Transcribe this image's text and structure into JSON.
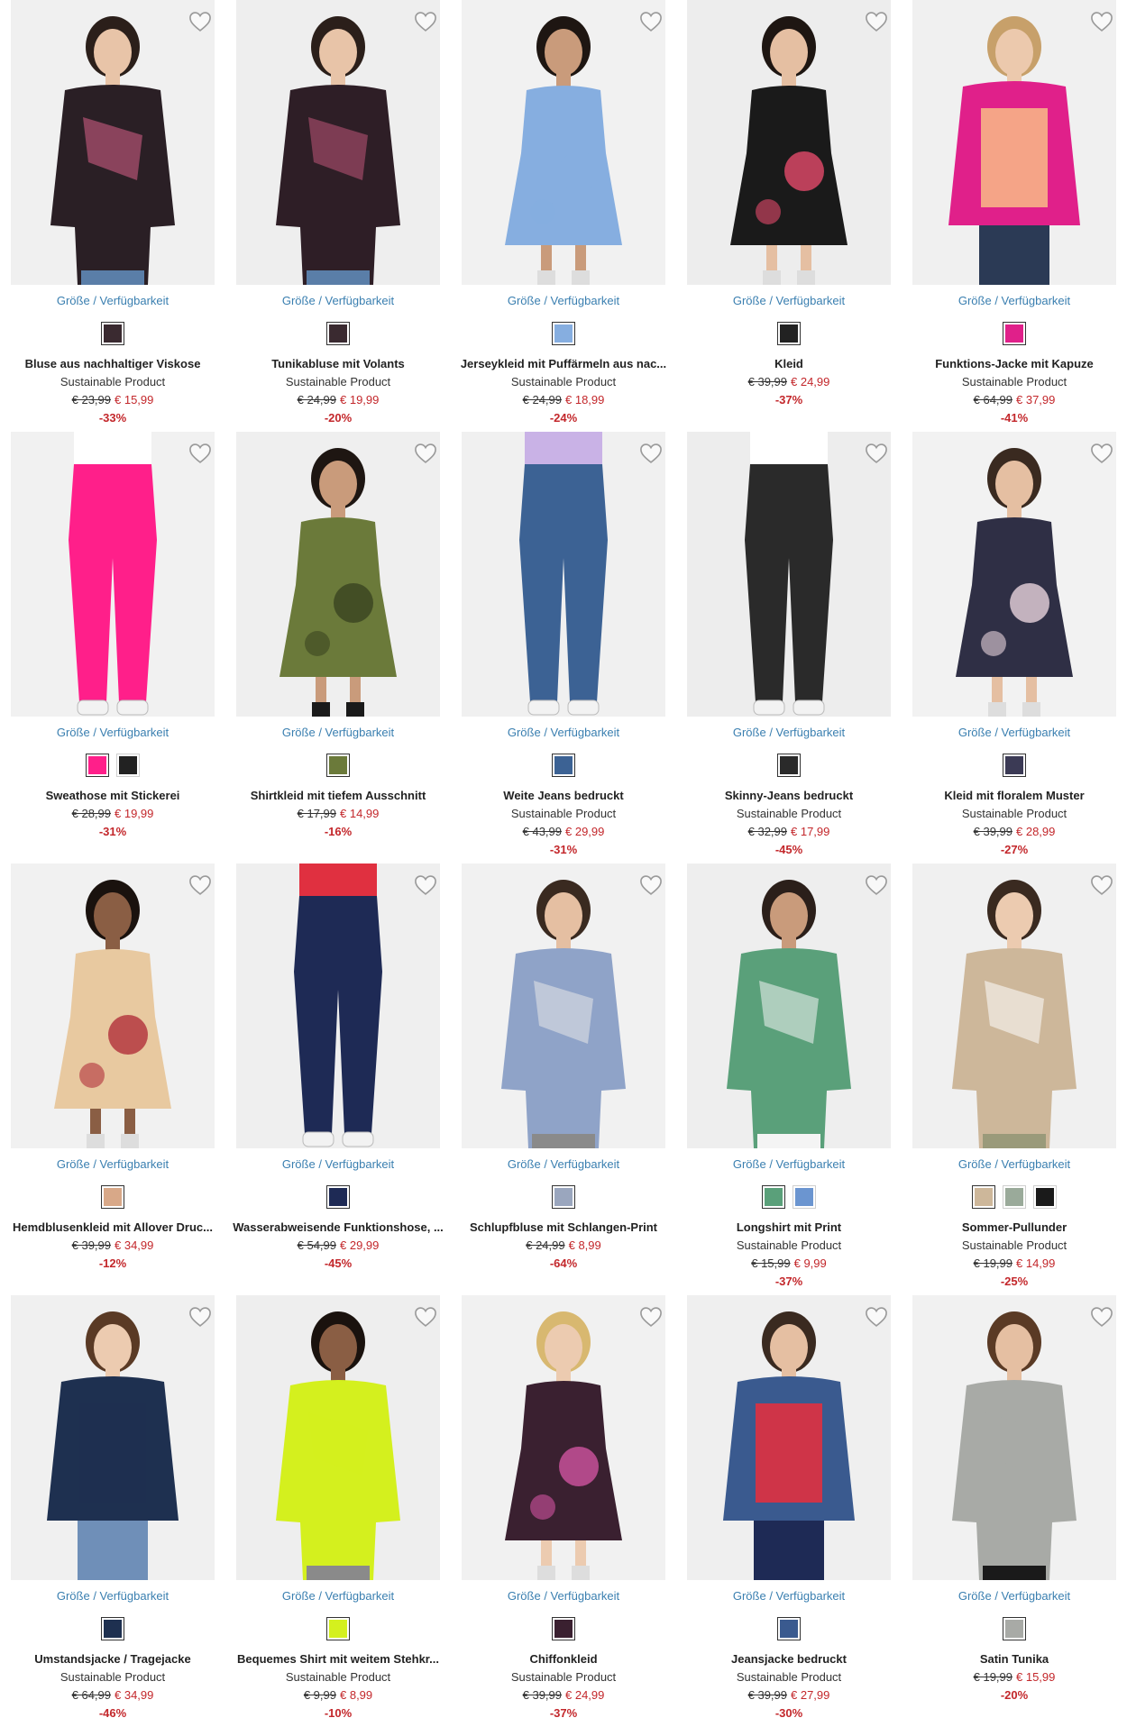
{
  "labels": {
    "availability": "Größe / Verfügbarkeit"
  },
  "colors": {
    "link": "#3a7fb0",
    "sale": "#c3272b",
    "text": "#222222"
  },
  "products": [
    {
      "title": "Bluse aus nachhaltiger Viskose",
      "subtitle": "Sustainable Product",
      "old_price": "€ 23,99",
      "new_price": "€ 15,99",
      "discount": "-33%",
      "bg": "#f0f0f0",
      "art": {
        "type": "top",
        "c1": "#2a1f25",
        "c2": "#d8608a",
        "skin": "#e8c4a8",
        "hair": "#2b1f1a"
      },
      "swatches": [
        "#3a2a30"
      ]
    },
    {
      "title": "Tunikabluse mit Volants",
      "subtitle": "Sustainable Product",
      "old_price": "€ 24,99",
      "new_price": "€ 19,99",
      "discount": "-20%",
      "bg": "#eeeeee",
      "art": {
        "type": "top",
        "c1": "#2e1e26",
        "c2": "#c05578",
        "skin": "#e8c4a8",
        "hair": "#2b1f1a",
        "legs": "#5a7ea8"
      },
      "swatches": [
        "#3a2a30"
      ]
    },
    {
      "title": "Jerseykleid mit Puffärmeln aus nac...",
      "subtitle": "Sustainable Product",
      "old_price": "€ 24,99",
      "new_price": "€ 18,99",
      "discount": "-24%",
      "bg": "#f1f1f1",
      "art": {
        "type": "dress",
        "c1": "#86aee0",
        "c2": "#86aee0",
        "skin": "#c99b7b",
        "hair": "#1e1612"
      },
      "swatches": [
        "#86aee0"
      ]
    },
    {
      "title": "Kleid",
      "subtitle": "",
      "old_price": "€ 39,99",
      "new_price": "€ 24,99",
      "discount": "-37%",
      "bg": "#ededed",
      "art": {
        "type": "dress",
        "c1": "#1a1a1a",
        "c2": "#e34a6a",
        "skin": "#e5bfa2",
        "hair": "#1e1612"
      },
      "swatches": [
        "#222222"
      ]
    },
    {
      "title": "Funktions-Jacke mit Kapuze",
      "subtitle": "Sustainable Product",
      "old_price": "€ 64,99",
      "new_price": "€ 37,99",
      "discount": "-41%",
      "bg": "#f0f0f0",
      "art": {
        "type": "jacket",
        "c1": "#e0208a",
        "c2": "#f7b286",
        "skin": "#ecc9ad",
        "hair": "#c7a06a",
        "legs": "#2b3a55"
      },
      "swatches": [
        "#e0208a"
      ]
    },
    {
      "title": "Sweathose mit Stickerei",
      "subtitle": "",
      "old_price": "€ 28,99",
      "new_price": "€ 19,99",
      "discount": "-31%",
      "bg": "#f1f1f1",
      "art": {
        "type": "pants",
        "c1": "#ff1f8a",
        "c2": "#ffffff",
        "skin": "#eccbb0",
        "hair": "#ffffff"
      },
      "swatches": [
        "#ff1f8a",
        "#222222"
      ]
    },
    {
      "title": "Shirtkleid mit tiefem Ausschnitt",
      "subtitle": "",
      "old_price": "€ 17,99",
      "new_price": "€ 14,99",
      "discount": "-16%",
      "bg": "#efefef",
      "art": {
        "type": "dress",
        "c1": "#6b7a3a",
        "c2": "#3a4420",
        "skin": "#c99b7b",
        "hair": "#1e1612",
        "boots": "#1a1a1a"
      },
      "swatches": [
        "#6b7a3a"
      ]
    },
    {
      "title": "Weite Jeans bedruckt",
      "subtitle": "Sustainable Product",
      "old_price": "€ 43,99",
      "new_price": "€ 29,99",
      "discount": "-31%",
      "bg": "#f0f0f0",
      "art": {
        "type": "pants",
        "c1": "#3c6294",
        "c2": "#c9b2e6",
        "skin": "#eccbb0",
        "hair": "#c9b2e6"
      },
      "swatches": [
        "#3c6294"
      ]
    },
    {
      "title": "Skinny-Jeans bedruckt",
      "subtitle": "Sustainable Product",
      "old_price": "€ 32,99",
      "new_price": "€ 17,99",
      "discount": "-45%",
      "bg": "#ededed",
      "art": {
        "type": "pants",
        "c1": "#2a2a2a",
        "c2": "#ffffff",
        "skin": "#eccbb0",
        "hair": "#ffffff"
      },
      "swatches": [
        "#2a2a2a"
      ]
    },
    {
      "title": "Kleid mit floralem Muster",
      "subtitle": "Sustainable Product",
      "old_price": "€ 39,99",
      "new_price": "€ 28,99",
      "discount": "-27%",
      "bg": "#f2f2f2",
      "art": {
        "type": "dress",
        "c1": "#2f2f45",
        "c2": "#e8d3dc",
        "skin": "#e5bfa2",
        "hair": "#3a2a20"
      },
      "swatches": [
        "#3b3a55"
      ]
    },
    {
      "title": "Hemdblusenkleid mit Allover Druc...",
      "subtitle": "",
      "old_price": "€ 39,99",
      "new_price": "€ 34,99",
      "discount": "-12%",
      "bg": "#f1f1f1",
      "art": {
        "type": "dress",
        "c1": "#e8c9a0",
        "c2": "#b0303a",
        "skin": "#8a5e44",
        "hair": "#1a120e"
      },
      "swatches": [
        "#d8a888"
      ]
    },
    {
      "title": "Wasserabweisende Funktionshose, ...",
      "subtitle": "",
      "old_price": "€ 54,99",
      "new_price": "€ 29,99",
      "discount": "-45%",
      "bg": "#efefef",
      "art": {
        "type": "pants",
        "c1": "#1e2a55",
        "c2": "#e03040",
        "skin": "#eccbb0",
        "hair": "#1e2a55"
      },
      "swatches": [
        "#1e2a55"
      ]
    },
    {
      "title": "Schlupfbluse mit Schlangen-Print",
      "subtitle": "",
      "old_price": "€ 24,99",
      "new_price": "€ 8,99",
      "discount": "-64%",
      "bg": "#f1f1f1",
      "art": {
        "type": "top",
        "c1": "#8fa3c8",
        "c2": "#e8e8e8",
        "skin": "#e5bfa2",
        "hair": "#3a2a20",
        "legs": "#8a8a8a"
      },
      "swatches": [
        "#9aa6be"
      ]
    },
    {
      "title": "Longshirt mit Print",
      "subtitle": "Sustainable Product",
      "old_price": "€ 15,99",
      "new_price": "€ 9,99",
      "discount": "-37%",
      "bg": "#eeeeee",
      "art": {
        "type": "top",
        "c1": "#5aa07a",
        "c2": "#f4f4f4",
        "skin": "#c99b7b",
        "hair": "#2b1f1a",
        "legs": "#f4f4f4"
      },
      "swatches": [
        "#5aa07a",
        "#6b95d0"
      ]
    },
    {
      "title": "Sommer-Pullunder",
      "subtitle": "Sustainable Product",
      "old_price": "€ 19,99",
      "new_price": "€ 14,99",
      "discount": "-25%",
      "bg": "#f0f0f0",
      "art": {
        "type": "top",
        "c1": "#cdb79a",
        "c2": "#ffffff",
        "skin": "#eccbb0",
        "hair": "#3a2a20",
        "legs": "#9a9a7a"
      },
      "swatches": [
        "#cdb79a",
        "#9aaa9a",
        "#1a1a1a"
      ]
    },
    {
      "title": "Umstandsjacke / Tragejacke",
      "subtitle": "Sustainable Product",
      "old_price": "€ 64,99",
      "new_price": "€ 34,99",
      "discount": "-46%",
      "bg": "#f0f0f0",
      "art": {
        "type": "jacket",
        "c1": "#1e3050",
        "c2": "#1e3050",
        "skin": "#eccbb0",
        "hair": "#5a3a25",
        "legs": "#6f8fb8"
      },
      "swatches": [
        "#1e3050"
      ]
    },
    {
      "title": "Bequemes Shirt mit weitem Stehkr...",
      "subtitle": "Sustainable Product",
      "old_price": "€ 9,99",
      "new_price": "€ 8,99",
      "discount": "-10%",
      "bg": "#eeeeee",
      "art": {
        "type": "top",
        "c1": "#d4f01e",
        "c2": "#d4f01e",
        "skin": "#8a5e44",
        "hair": "#1a120e",
        "legs": "#8a8a8a"
      },
      "swatches": [
        "#d4f01e"
      ]
    },
    {
      "title": "Chiffonkleid",
      "subtitle": "Sustainable Product",
      "old_price": "€ 39,99",
      "new_price": "€ 24,99",
      "discount": "-37%",
      "bg": "#f1f1f1",
      "art": {
        "type": "dress",
        "c1": "#3a2030",
        "c2": "#d054a0",
        "skin": "#eccbb0",
        "hair": "#d8b870"
      },
      "swatches": [
        "#3a2030"
      ]
    },
    {
      "title": "Jeansjacke bedruckt",
      "subtitle": "Sustainable Product",
      "old_price": "€ 39,99",
      "new_price": "€ 27,99",
      "discount": "-30%",
      "bg": "#efefef",
      "art": {
        "type": "jacket",
        "c1": "#3a5a8f",
        "c2": "#e03040",
        "skin": "#e5bfa2",
        "hair": "#3a2a20",
        "legs": "#1e2a55"
      },
      "swatches": [
        "#3a5a8f"
      ]
    },
    {
      "title": "Satin Tunika",
      "subtitle": "",
      "old_price": "€ 19,99",
      "new_price": "€ 15,99",
      "discount": "-20%",
      "bg": "#f1f1f1",
      "art": {
        "type": "top",
        "c1": "#a8aaa6",
        "c2": "#a8aaa6",
        "skin": "#e5bfa2",
        "hair": "#5a3a25",
        "legs": "#1a1a1a"
      },
      "swatches": [
        "#a8aaa6"
      ]
    }
  ]
}
